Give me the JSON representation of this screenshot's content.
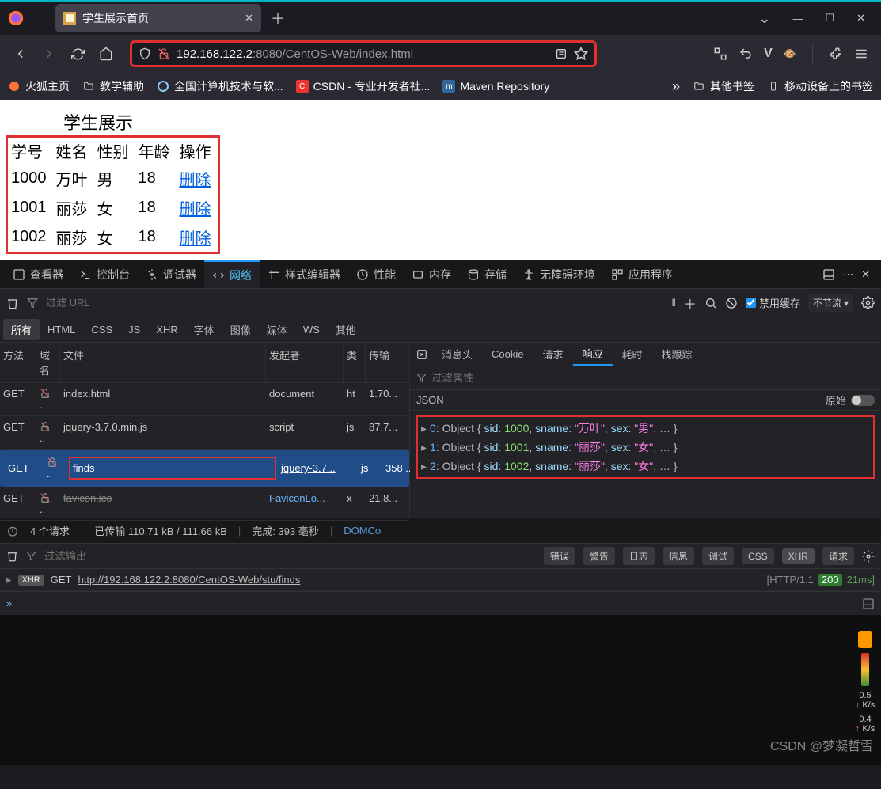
{
  "window": {
    "title": "学生展示首页"
  },
  "url": {
    "host": "192.168.122.2",
    "port": ":8080",
    "path": "/CentOS-Web/index.html"
  },
  "bookmarks": {
    "b1": "火狐主页",
    "b2": "教学辅助",
    "b3": "全国计算机技术与软...",
    "b4": "CSDN - 专业开发者社...",
    "b5": "Maven Repository",
    "r1": "其他书签",
    "r2": "移动设备上的书签"
  },
  "page": {
    "title": "学生展示",
    "headers": {
      "id": "学号",
      "name": "姓名",
      "sex": "性别",
      "age": "年龄",
      "ops": "操作"
    },
    "rows": [
      {
        "id": "1000",
        "name": "万叶",
        "sex": "男",
        "age": "18",
        "del": "删除"
      },
      {
        "id": "1001",
        "name": "丽莎",
        "sex": "女",
        "age": "18",
        "del": "删除"
      },
      {
        "id": "1002",
        "name": "丽莎",
        "sex": "女",
        "age": "18",
        "del": "删除"
      }
    ]
  },
  "devtabs": {
    "inspector": "查看器",
    "console": "控制台",
    "debugger": "调试器",
    "network": "网络",
    "style": "样式编辑器",
    "perf": "性能",
    "memory": "内存",
    "storage": "存储",
    "a11y": "无障碍环境",
    "app": "应用程序"
  },
  "nettool": {
    "filter_ph": "过滤 URL",
    "disable_cache": "禁用缓存",
    "throttle": "不节流"
  },
  "netfilters": {
    "all": "所有",
    "html": "HTML",
    "css": "CSS",
    "js": "JS",
    "xhr": "XHR",
    "font": "字体",
    "img": "图像",
    "media": "媒体",
    "ws": "WS",
    "other": "其他"
  },
  "netcols": {
    "method": "方法",
    "domain": "域名",
    "file": "文件",
    "initiator": "发起者",
    "type": "类",
    "transfer": "传输"
  },
  "reqs": [
    {
      "m": "GET",
      "f": "index.html",
      "i": "document",
      "t": "ht",
      "x": "1.70..."
    },
    {
      "m": "GET",
      "f": "jquery-3.7.0.min.js",
      "i": "script",
      "t": "js",
      "x": "87.7..."
    },
    {
      "m": "GET",
      "f": "finds",
      "i": "jquery-3.7...",
      "t": "js",
      "x": "358 ...",
      "sel": true,
      "hl": true,
      "ilink": true
    },
    {
      "m": "GET",
      "f": "favicon.ico",
      "i": "FaviconLo...",
      "t": "x-",
      "x": "21.8...",
      "ilink": true,
      "strike": true
    }
  ],
  "resp_tabs": {
    "headers": "消息头",
    "cookie": "Cookie",
    "request": "请求",
    "response": "响应",
    "timing": "耗时",
    "stack": "栈跟踪"
  },
  "resp": {
    "filter_ph": "过滤属性",
    "json": "JSON",
    "raw": "原始"
  },
  "json_rows": [
    {
      "idx": "0",
      "sid": "1000",
      "sname": "万叶",
      "sex": "男"
    },
    {
      "idx": "1",
      "sid": "1001",
      "sname": "丽莎",
      "sex": "女"
    },
    {
      "idx": "2",
      "sid": "1002",
      "sname": "丽莎",
      "sex": "女"
    }
  ],
  "status": {
    "count": "4 个请求",
    "transfer": "已传输 110.71 kB / 111.66 kB",
    "finish": "完成: 393 毫秒",
    "domc": "DOMCo"
  },
  "console": {
    "filter_ph": "过滤输出",
    "pills": {
      "err": "错误",
      "warn": "警告",
      "log": "日志",
      "info": "信息",
      "debug": "调试",
      "css": "CSS",
      "xhr": "XHR",
      "req": "请求"
    },
    "row": {
      "badge": "XHR",
      "method": "GET",
      "url": "http://192.168.122.2:8080/CentOS-Web/stu/finds",
      "proto": "[HTTP/1.1",
      "code": "200",
      "time": "21ms]"
    }
  },
  "watermark": "CSDN @梦凝哲雪",
  "overlay": {
    "v1": "0.5",
    "u1": "K/s",
    "v2": "0.4",
    "u2": "K/s"
  }
}
